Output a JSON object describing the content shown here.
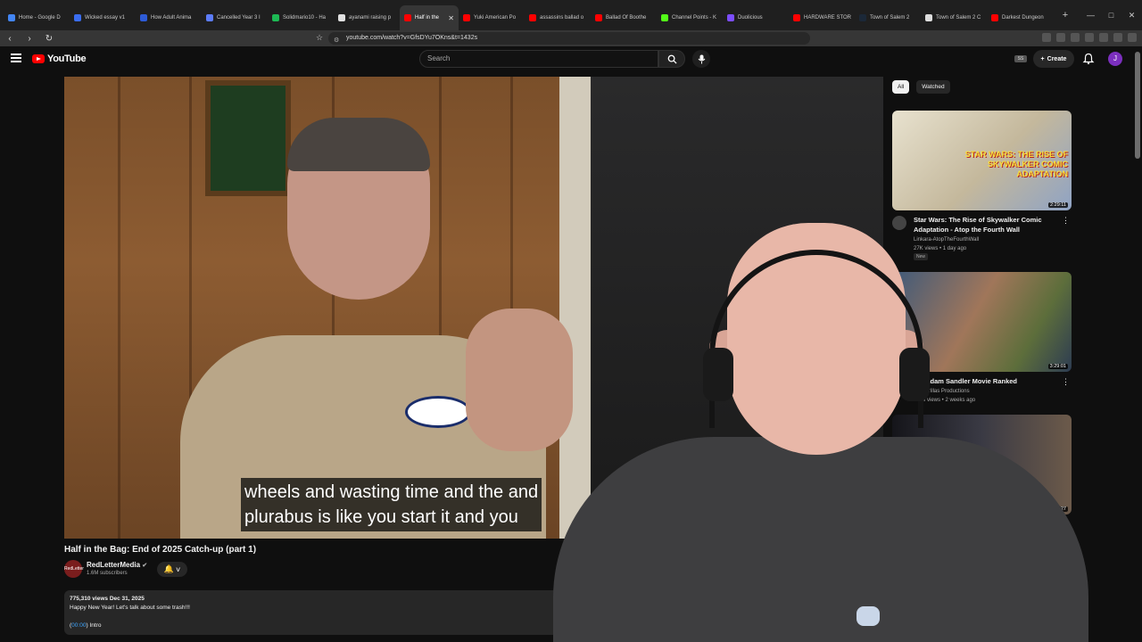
{
  "browser": {
    "tabs": [
      {
        "label": "Home - Google D",
        "color": "#4285f4"
      },
      {
        "label": "Wicked essay v1",
        "color": "#3a6df0"
      },
      {
        "label": "How Adult Anima",
        "color": "#2d5bd6"
      },
      {
        "label": "Cancelled Year 3 I",
        "color": "#5c7cfa"
      },
      {
        "label": "Solidmario10 - Ha",
        "color": "#1db954"
      },
      {
        "label": "ayanami raising p",
        "color": "#e0e0e0"
      },
      {
        "label": "Half in the",
        "color": "#ff0000"
      },
      {
        "label": "Yuki American Po",
        "color": "#ff0000"
      },
      {
        "label": "assassins ballad o",
        "color": "#ff0000"
      },
      {
        "label": "Ballad Of Boothe",
        "color": "#ff0000"
      },
      {
        "label": "Channel Points - K",
        "color": "#53fc18"
      },
      {
        "label": "Duolicious",
        "color": "#7c4dff"
      },
      {
        "label": "HARDWARE STOR",
        "color": "#ff0000"
      },
      {
        "label": "Town of Salem 2",
        "color": "#1b2838"
      },
      {
        "label": "Town of Salem 2 C",
        "color": "#dddddd"
      },
      {
        "label": "Darkest Dungeon",
        "color": "#ff0000"
      }
    ],
    "new_tab": "+",
    "url": "youtube.com/watch?v=GfsDYu7OKns&t=1432s"
  },
  "youtube": {
    "logo_text": "YouTube",
    "search_placeholder": "Search",
    "create_label": "Create",
    "avatar_letter": "J",
    "ss_badge": "SS"
  },
  "video": {
    "caption_line1": "wheels and wasting time and the and",
    "caption_line2": "plurabus is like you start it and you",
    "title": "Half in the Bag: End of 2025 Catch-up (part 1)",
    "channel": "RedLetterMedia",
    "subscribers": "1.6M subscribers",
    "channel_avatar_text": "RedLetter",
    "views_date": "775,310 views  Dec 31, 2025",
    "description": "Happy New Year! Let's talk about some trash!!!",
    "chapter_time": "00:00",
    "chapter_label": "Intro"
  },
  "sidebar": {
    "chips": [
      "All",
      "Watched"
    ],
    "recommendations": [
      {
        "title": "Star Wars: The Rise of Skywalker Comic Adaptation - Atop the Fourth Wall",
        "channel": "Linkara-AtopTheFourthWall",
        "meta": "27K views • 1 day ago",
        "badge": "New",
        "duration": "2:29:11",
        "thumb_text": "STAR WARS: THE RISE OF SKYWALKER COMIC ADAPTATION"
      },
      {
        "title": "ery Adam Sandler Movie Ranked",
        "channel": "Schaffrillas Productions",
        "meta": "1.1M views • 2 weeks ago",
        "duration": "3:29:01"
      },
      {
        "title": "",
        "duration": "5:27"
      }
    ]
  }
}
